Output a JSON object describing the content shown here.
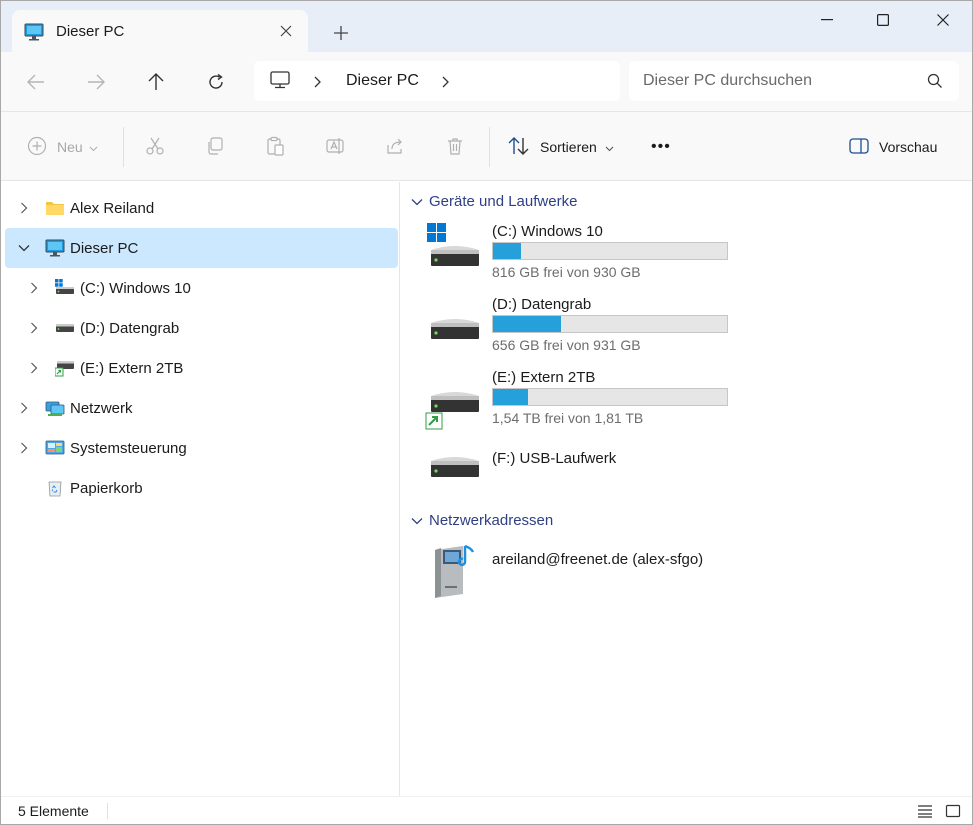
{
  "tab": {
    "title": "Dieser PC",
    "icon": "pc-icon"
  },
  "window_controls": {
    "minimize": "minimize-icon",
    "maximize": "maximize-icon",
    "close": "close-icon"
  },
  "address": {
    "location": "Dieser PC"
  },
  "search": {
    "placeholder": "Dieser PC durchsuchen"
  },
  "toolbar": {
    "new_label": "Neu",
    "sort_label": "Sortieren",
    "more_label": "•••",
    "preview_label": "Vorschau"
  },
  "sidebar": {
    "items": [
      {
        "label": "Alex Reiland",
        "icon": "folder-icon"
      },
      {
        "label": "Dieser PC",
        "icon": "pc-icon",
        "selected": true
      },
      {
        "label": "(C:) Windows 10",
        "icon": "windows-drive-icon"
      },
      {
        "label": "(D:) Datengrab",
        "icon": "drive-icon"
      },
      {
        "label": "(E:) Extern 2TB",
        "icon": "shared-drive-icon"
      },
      {
        "label": "Netzwerk",
        "icon": "network-icon"
      },
      {
        "label": "Systemsteuerung",
        "icon": "control-panel-icon"
      },
      {
        "label": "Papierkorb",
        "icon": "recycle-bin-icon"
      }
    ]
  },
  "groups": {
    "devices": {
      "title": "Geräte und Laufwerke"
    },
    "network": {
      "title": "Netzwerkadressen"
    }
  },
  "drives": [
    {
      "name": "(C:) Windows 10",
      "free": "816 GB frei von 930 GB",
      "used_fraction": 0.12,
      "icon": "windows-drive-icon"
    },
    {
      "name": "(D:) Datengrab",
      "free": "656 GB frei von 931 GB",
      "used_fraction": 0.29,
      "icon": "drive-icon"
    },
    {
      "name": "(E:) Extern 2TB",
      "free": "1,54 TB frei von 1,81 TB",
      "used_fraction": 0.15,
      "icon": "shared-drive-icon"
    },
    {
      "name": "(F:) USB-Laufwerk",
      "icon": "drive-icon"
    }
  ],
  "network_locations": [
    {
      "name": "areiland@freenet.de (alex-sfgo)",
      "icon": "media-server-icon"
    }
  ],
  "status": {
    "count": "5 Elemente"
  },
  "colors": {
    "accent": "#26a0da",
    "selection": "#cce8ff",
    "group_header": "#2f3f86"
  }
}
